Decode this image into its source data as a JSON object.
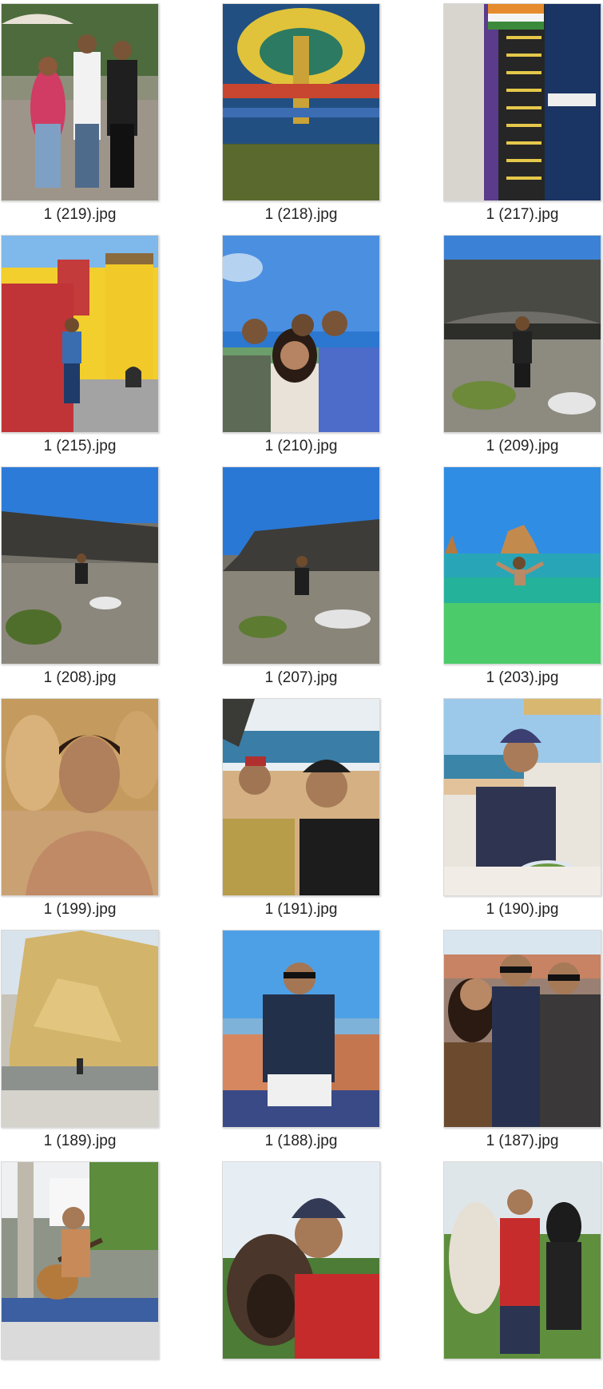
{
  "files": [
    {
      "name": "1 (219).jpg",
      "thumb_icon": "group-street-photo"
    },
    {
      "name": "1 (218).jpg",
      "thumb_icon": "street-mural-photo"
    },
    {
      "name": "1 (217).jpg",
      "thumb_icon": "graffiti-wall-photo"
    },
    {
      "name": "1 (215).jpg",
      "thumb_icon": "yellow-palace-photo"
    },
    {
      "name": "1 (210).jpg",
      "thumb_icon": "group-selfie-photo"
    },
    {
      "name": "1 (209).jpg",
      "thumb_icon": "rock-cave-photo"
    },
    {
      "name": "1 (208).jpg",
      "thumb_icon": "rocky-coast-photo"
    },
    {
      "name": "1 (207).jpg",
      "thumb_icon": "rocky-coast-photo"
    },
    {
      "name": "1 (203).jpg",
      "thumb_icon": "sea-swim-photo"
    },
    {
      "name": "1 (199).jpg",
      "thumb_icon": "cliff-selfie-photo"
    },
    {
      "name": "1 (191).jpg",
      "thumb_icon": "beach-selfie-photo"
    },
    {
      "name": "1 (190).jpg",
      "thumb_icon": "cafe-drink-photo"
    },
    {
      "name": "1 (189).jpg",
      "thumb_icon": "sandstone-cliff-photo"
    },
    {
      "name": "1 (188).jpg",
      "thumb_icon": "city-view-photo"
    },
    {
      "name": "1 (187).jpg",
      "thumb_icon": "friends-group-photo"
    },
    {
      "name": "",
      "thumb_icon": "guitar-player-photo"
    },
    {
      "name": "",
      "thumb_icon": "alpaca-selfie-photo"
    },
    {
      "name": "",
      "thumb_icon": "alpaca-couple-photo"
    }
  ]
}
